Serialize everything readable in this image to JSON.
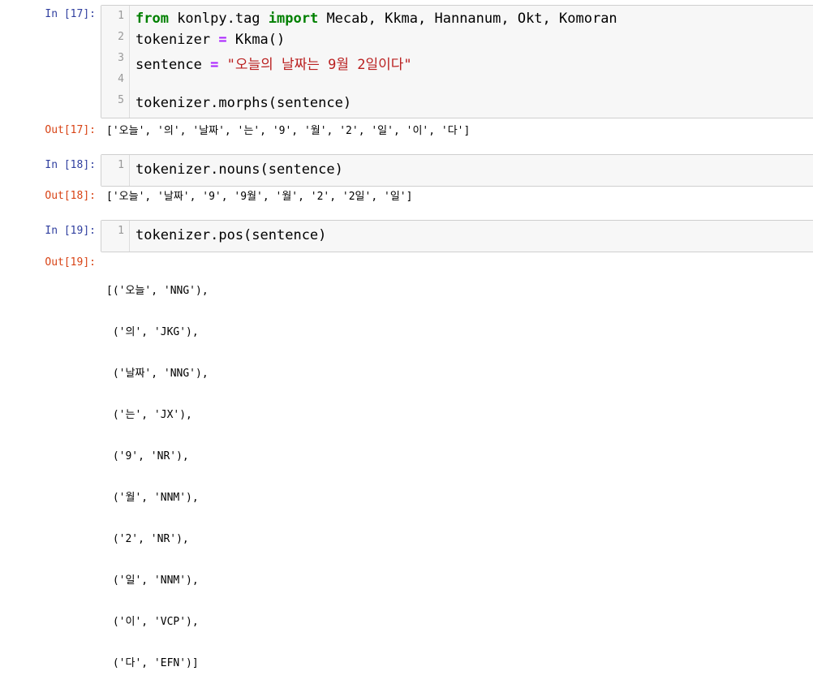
{
  "cells": [
    {
      "in_prompt": "In [17]:",
      "out_prompt": "Out[17]:",
      "line_numbers": [
        "1",
        "2",
        "3",
        "4",
        "5"
      ],
      "code": {
        "l1_kw_from": "from",
        "l1_mod": " konlpy.tag ",
        "l1_kw_import": "import",
        "l1_rest": " Mecab, Kkma, Hannanum, Okt, Komoran",
        "l2_a": "tokenizer ",
        "l2_op": "=",
        "l2_b": " Kkma()",
        "l3_a": "sentence ",
        "l3_op": "=",
        "l3_str": " \"오늘의 날짜는 9월 2일이다\"",
        "l4": "",
        "l5": "tokenizer.morphs(sentence)"
      },
      "output": "['오늘', '의', '날짜', '는', '9', '월', '2', '일', '이', '다']"
    },
    {
      "in_prompt": "In [18]:",
      "out_prompt": "Out[18]:",
      "line_numbers": [
        "1"
      ],
      "code": {
        "l1": "tokenizer.nouns(sentence)"
      },
      "output": "['오늘', '날짜', '9', '9월', '월', '2', '2일', '일']"
    },
    {
      "in_prompt": "In [19]:",
      "out_prompt": "Out[19]:",
      "line_numbers": [
        "1"
      ],
      "code": {
        "l1": "tokenizer.pos(sentence)"
      },
      "output_lines": [
        "[('오늘', 'NNG'),",
        " ('의', 'JKG'),",
        " ('날짜', 'NNG'),",
        " ('는', 'JX'),",
        " ('9', 'NR'),",
        " ('월', 'NNM'),",
        " ('2', 'NR'),",
        " ('일', 'NNM'),",
        " ('이', 'VCP'),",
        " ('다', 'EFN')]"
      ]
    }
  ]
}
